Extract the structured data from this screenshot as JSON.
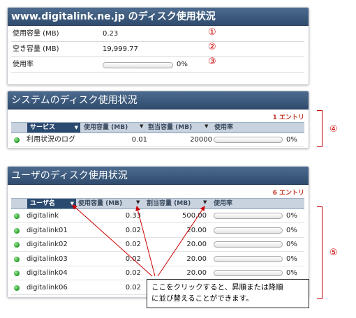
{
  "panel1": {
    "title": "www.digitalink.ne.jp のディスク使用状況",
    "rows": [
      {
        "label": "使用容量 (MB)",
        "value": "0.23",
        "marker": "①"
      },
      {
        "label": "空き容量 (MB)",
        "value": "19,999.77",
        "marker": "②"
      },
      {
        "label": "使用率",
        "percent": "0%",
        "usage": 0,
        "marker": "③"
      }
    ]
  },
  "panel2": {
    "title": "システムのディスク使用状況",
    "entries": "1 エントリ",
    "headers": {
      "service": "サービス",
      "used": "使用容量 (MB)",
      "quota": "割当容量 (MB)",
      "rate": "使用率"
    },
    "rows": [
      {
        "name": "利用状況のログ",
        "used": "0.01",
        "quota": "20000",
        "percent": "0%",
        "usage": 0
      }
    ],
    "marker": "④"
  },
  "panel3": {
    "title": "ユーザのディスク使用状況",
    "entries": "6 エントリ",
    "headers": {
      "user": "ユーザ名",
      "used": "使用容量 (MB)",
      "quota": "割当容量 (MB)",
      "rate": "使用率"
    },
    "rows": [
      {
        "name": "digitalink",
        "used": "0.33",
        "quota": "500.00",
        "percent": "0%",
        "usage": 0
      },
      {
        "name": "digitalink01",
        "used": "0.02",
        "quota": "20.00",
        "percent": "0%",
        "usage": 0
      },
      {
        "name": "digitalink02",
        "used": "0.02",
        "quota": "20.00",
        "percent": "0%",
        "usage": 0
      },
      {
        "name": "digitalink03",
        "used": "0.02",
        "quota": "20.00",
        "percent": "0%",
        "usage": 0
      },
      {
        "name": "digitalink04",
        "used": "0.02",
        "quota": "20.00",
        "percent": "0%",
        "usage": 0
      },
      {
        "name": "digitalink06",
        "used": "0.02",
        "quota": "20.00",
        "percent": "0%",
        "usage": 0
      }
    ],
    "marker": "⑤"
  },
  "callout": {
    "line1": "ここをクリックすると、昇順または降順",
    "line2": "に並び替えることができます。"
  },
  "colors": {
    "header": "#2f4c6e",
    "status_green": "#1f9a1f",
    "annotation_red": "#cc0000"
  }
}
